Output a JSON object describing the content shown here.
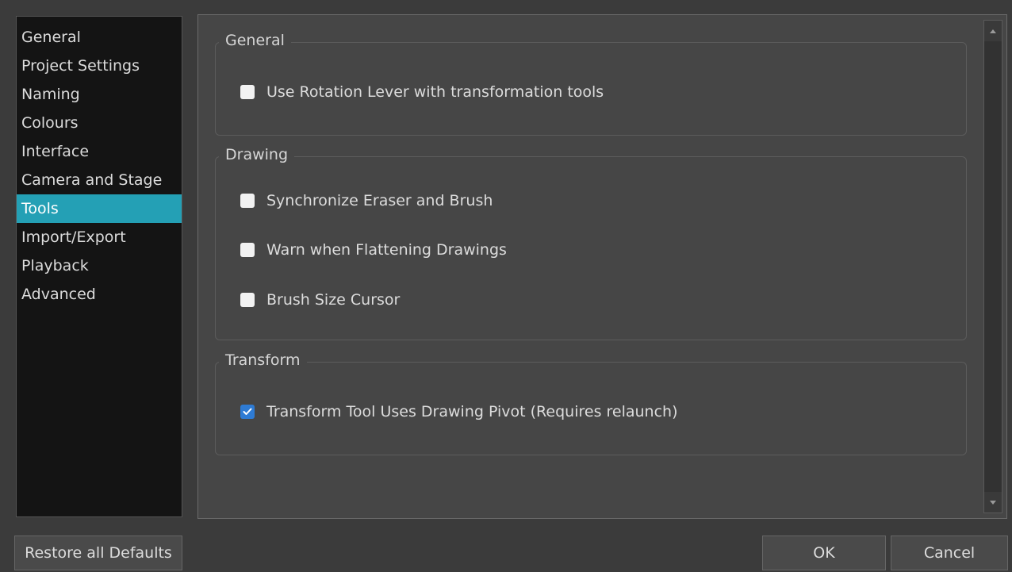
{
  "sidebar": {
    "items": [
      {
        "label": "General"
      },
      {
        "label": "Project Settings"
      },
      {
        "label": "Naming"
      },
      {
        "label": "Colours"
      },
      {
        "label": "Interface"
      },
      {
        "label": "Camera and Stage"
      },
      {
        "label": "Tools"
      },
      {
        "label": "Import/Export"
      },
      {
        "label": "Playback"
      },
      {
        "label": "Advanced"
      }
    ],
    "selected": "Tools"
  },
  "groups": {
    "general": {
      "title": "General",
      "options": [
        {
          "label": "Use Rotation Lever with transformation tools",
          "checked": false
        }
      ]
    },
    "drawing": {
      "title": "Drawing",
      "options": [
        {
          "label": "Synchronize Eraser and Brush",
          "checked": false
        },
        {
          "label": "Warn when Flattening Drawings",
          "checked": false
        },
        {
          "label": "Brush Size Cursor",
          "checked": false
        }
      ]
    },
    "transform": {
      "title": "Transform",
      "options": [
        {
          "label": "Transform Tool Uses Drawing Pivot (Requires relaunch)",
          "checked": true
        }
      ]
    }
  },
  "buttons": {
    "restore": "Restore all Defaults",
    "ok": "OK",
    "cancel": "Cancel"
  },
  "colors": {
    "selection": "#24a0b5",
    "checkbox_checked": "#2e7bd4"
  }
}
